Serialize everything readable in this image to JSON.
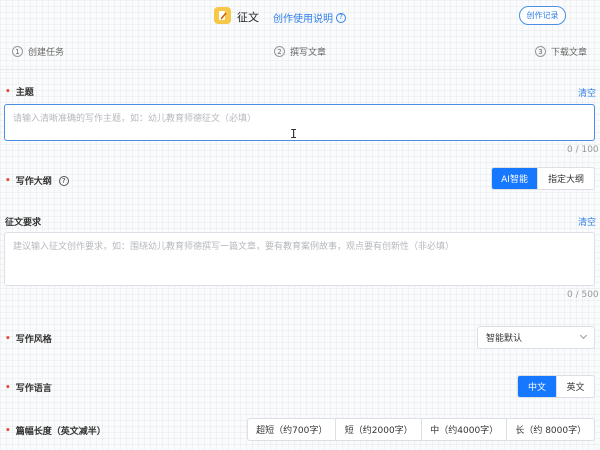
{
  "header": {
    "app_title": "征文",
    "guide_link": "创作使用说明",
    "record_button": "创作记录"
  },
  "steps": [
    {
      "num": "1",
      "label": "创建任务"
    },
    {
      "num": "2",
      "label": "撰写文章"
    },
    {
      "num": "3",
      "label": "下载文章"
    }
  ],
  "topic": {
    "label": "主题",
    "clear": "清空",
    "placeholder": "请输入清晰准确的写作主题，如：幼儿教育师德征文（必填）",
    "counter": "0 / 100"
  },
  "outline": {
    "label": "写作大纲",
    "options": [
      "AI智能",
      "指定大纲"
    ],
    "selected": "AI智能"
  },
  "requirements": {
    "label": "征文要求",
    "clear": "清空",
    "placeholder": "建议输入征文创作要求，如：围绕幼儿教育师德撰写一篇文章，要有教育案例故事，观点要有创新性（非必填）",
    "counter": "0 / 500"
  },
  "style": {
    "label": "写作风格",
    "value": "智能默认"
  },
  "language": {
    "label": "写作语言",
    "options": [
      "中文",
      "英文"
    ],
    "selected": "中文"
  },
  "length": {
    "label": "篇幅长度（英文减半）",
    "options": [
      "超短（约700字）",
      "短（约2000字）",
      "中（约4000字）",
      "长（约 8000字）"
    ]
  },
  "colors": {
    "accent": "#1677ff",
    "link": "#2f7fe8",
    "required": "#e74c3c"
  }
}
